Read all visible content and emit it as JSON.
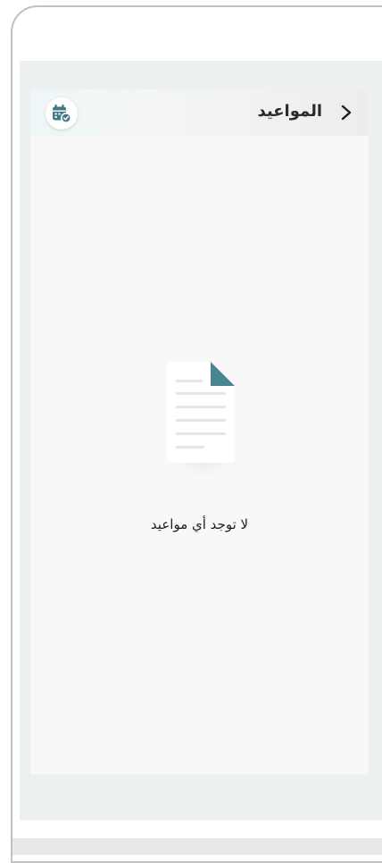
{
  "header": {
    "title": "المواعيد",
    "back_icon": "chevron-right-icon",
    "calendar_icon": "calendar-check-icon"
  },
  "empty_state": {
    "icon": "document-icon",
    "message": "لا توجد أي مواعيد"
  },
  "colors": {
    "accent": "#3f7a84",
    "background": "#f8f8f8",
    "screen_background": "#edf0f1"
  }
}
